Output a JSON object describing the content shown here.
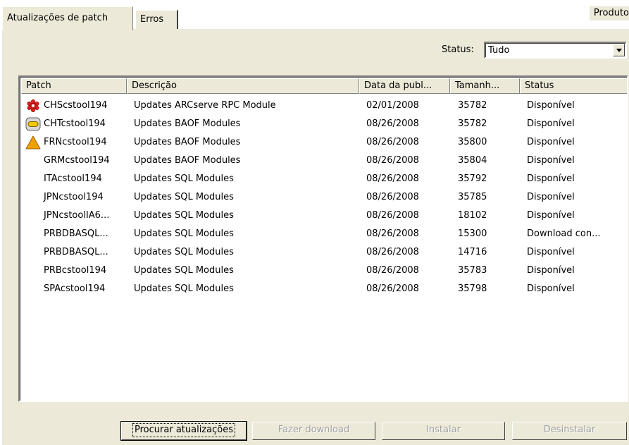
{
  "tabs": [
    {
      "label": "Atualizações de patch",
      "active": true
    },
    {
      "label": "Erros",
      "active": false
    }
  ],
  "product_label": "Produto",
  "filter": {
    "label": "Status:",
    "value": "Tudo"
  },
  "columns": [
    "Patch",
    "Descrição",
    "Data da publ...",
    "Tamanh...",
    "Status"
  ],
  "rows": [
    {
      "icon": "error-icon",
      "patch": "CHScstool194",
      "description": "Updates ARCserve RPC Module",
      "date": "02/01/2008",
      "size": "35782",
      "status": "Disponível"
    },
    {
      "icon": "info-icon",
      "patch": "CHTcstool194",
      "description": "Updates BAOF Modules",
      "date": "08/26/2008",
      "size": "35782",
      "status": "Disponível"
    },
    {
      "icon": "warning-icon",
      "patch": "FRNcstool194",
      "description": "Updates BAOF Modules",
      "date": "08/26/2008",
      "size": "35800",
      "status": "Disponível"
    },
    {
      "icon": "",
      "patch": "GRMcstool194",
      "description": "Updates BAOF Modules",
      "date": "08/26/2008",
      "size": "35804",
      "status": "Disponível"
    },
    {
      "icon": "",
      "patch": "ITAcstool194",
      "description": "Updates SQL Modules",
      "date": "08/26/2008",
      "size": "35792",
      "status": "Disponível"
    },
    {
      "icon": "",
      "patch": "JPNcstool194",
      "description": "Updates SQL Modules",
      "date": "08/26/2008",
      "size": "35785",
      "status": "Disponível"
    },
    {
      "icon": "",
      "patch": "JPNcstoolIA6...",
      "description": "Updates SQL Modules",
      "date": "08/26/2008",
      "size": "18102",
      "status": "Disponível"
    },
    {
      "icon": "",
      "patch": "PRBDBASQL...",
      "description": "Updates SQL Modules",
      "date": "08/26/2008",
      "size": "15300",
      "status": "Download con..."
    },
    {
      "icon": "",
      "patch": "PRBDBASQL...",
      "description": "Updates SQL Modules",
      "date": "08/26/2008",
      "size": "14716",
      "status": "Disponível"
    },
    {
      "icon": "",
      "patch": "PRBcstool194",
      "description": "Updates SQL Modules",
      "date": "08/26/2008",
      "size": "35783",
      "status": "Disponível"
    },
    {
      "icon": "",
      "patch": "SPAcstool194",
      "description": "Updates SQL Modules",
      "date": "08/26/2008",
      "size": "35798",
      "status": "Disponível"
    }
  ],
  "buttons": {
    "check": "Procurar atualizações",
    "download": "Fazer download",
    "install": "Instalar",
    "uninstall": "Desinstalar"
  }
}
